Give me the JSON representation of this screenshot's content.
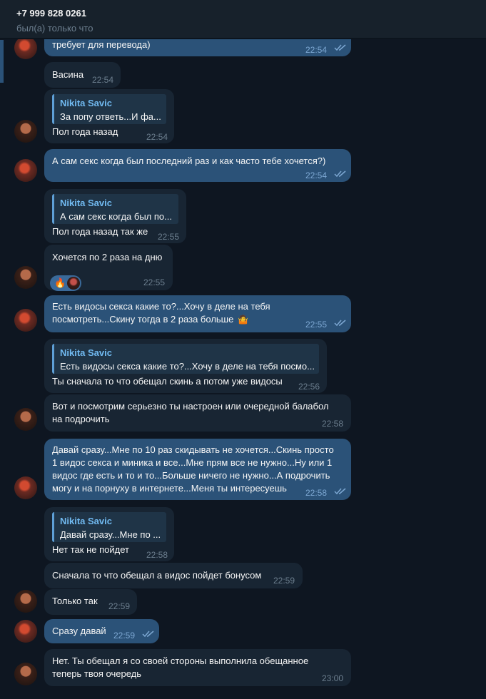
{
  "header": {
    "title": "+7 999 828 0261",
    "status": "был(а) только что"
  },
  "messages": [
    {
      "text": "требует для перевода)",
      "time": "22:54"
    },
    {
      "text": "Васина",
      "time": "22:54"
    },
    {
      "quote_name": "Nikita Savic",
      "quote_text": "За попу ответь...И фа...",
      "text": "Пол года назад",
      "time": "22:54"
    },
    {
      "text": "А сам секс когда был последний раз и как часто тебе хочется?)",
      "time": "22:54"
    },
    {
      "quote_name": "Nikita Savic",
      "quote_text": "А сам секс когда был по...",
      "text": "Пол года назад так же",
      "time": "22:55"
    },
    {
      "text": "Хочется по 2 раза на дню",
      "time": "22:55",
      "reaction": "🔥"
    },
    {
      "line1": "Есть видосы секса какие то?...Хочу в деле на тебя",
      "line2": "посмотреть...Скину тогда в 2 раза больше",
      "time": "22:55"
    },
    {
      "quote_name": "Nikita Savic",
      "quote_text": "Есть видосы секса какие то?...Хочу в деле на тебя посмо...",
      "text": "Ты сначала то что обещал скинь а потом уже видосы",
      "time": "22:56"
    },
    {
      "line1": "Вот и посмотрим серьезно ты настроен или очередной балабол",
      "line2": "на подрочить",
      "time": "22:58"
    },
    {
      "line1": "Давай сразу...Мне по 10 раз скидывать не хочется...Скинь просто",
      "line2": "1 видос секса и миника и все...Мне прям все не нужно...Ну или 1",
      "line3": "видос где есть и то и то...Больше ничего не нужно...А подрочить",
      "line4": "могу и на порнуху в интернете...Меня ты интересуешь",
      "time": "22:58"
    },
    {
      "quote_name": "Nikita Savic",
      "quote_text": "Давай сразу...Мне по ...",
      "text": "Нет так не пойдет",
      "time": "22:58"
    },
    {
      "text": "Сначала то что обещал а видос пойдет бонусом",
      "time": "22:59"
    },
    {
      "text": "Только так",
      "time": "22:59"
    },
    {
      "text": "Сразу давай",
      "time": "22:59"
    },
    {
      "line1": "Нет. Ты обещал я со своей стороны выполнила обещанное",
      "line2": "теперь твоя очередь",
      "time": "23:00"
    }
  ]
}
